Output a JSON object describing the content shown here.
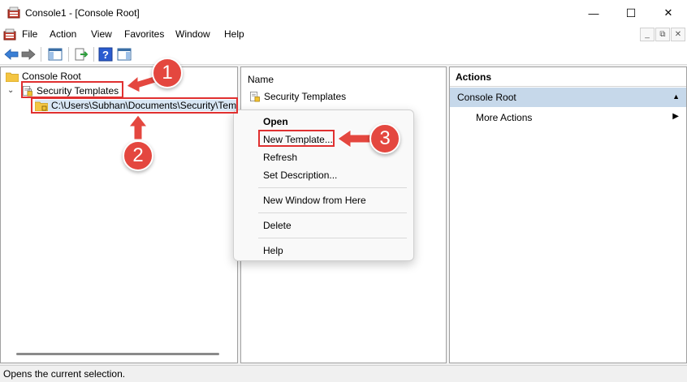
{
  "window": {
    "title": "Console1 - [Console Root]",
    "minimize_glyph": "—",
    "maximize_glyph": "☐",
    "close_glyph": "✕"
  },
  "menubar": {
    "items": [
      "File",
      "Action",
      "View",
      "Favorites",
      "Window",
      "Help"
    ],
    "mdi_min": "_",
    "mdi_restore": "⧉",
    "mdi_close": "✕"
  },
  "toolbar": {
    "buttons": [
      "back-icon",
      "forward-icon",
      "show-hide-console-tree-icon",
      "export-list-icon",
      "help-icon",
      "show-hide-action-pane-icon"
    ]
  },
  "tree": {
    "root_label": "Console Root",
    "expander": "⌄",
    "security_templates_label": "Security Templates",
    "path_label": "C:\\Users\\Subhan\\Documents\\Security\\Tem"
  },
  "list": {
    "column_name": "Name",
    "items": [
      "Security Templates"
    ]
  },
  "actions": {
    "header": "Actions",
    "section_title": "Console Root",
    "section_caret": "▲",
    "more_actions": "More Actions",
    "more_arrow": "▶"
  },
  "context_menu": {
    "open": "Open",
    "new_template": "New Template...",
    "refresh": "Refresh",
    "set_description": "Set Description...",
    "new_window": "New Window from Here",
    "delete": "Delete",
    "help": "Help"
  },
  "status": {
    "text": "Opens the current selection."
  },
  "annotations": {
    "step1": "1",
    "step2": "2",
    "step3": "3",
    "color": "#e03030"
  }
}
